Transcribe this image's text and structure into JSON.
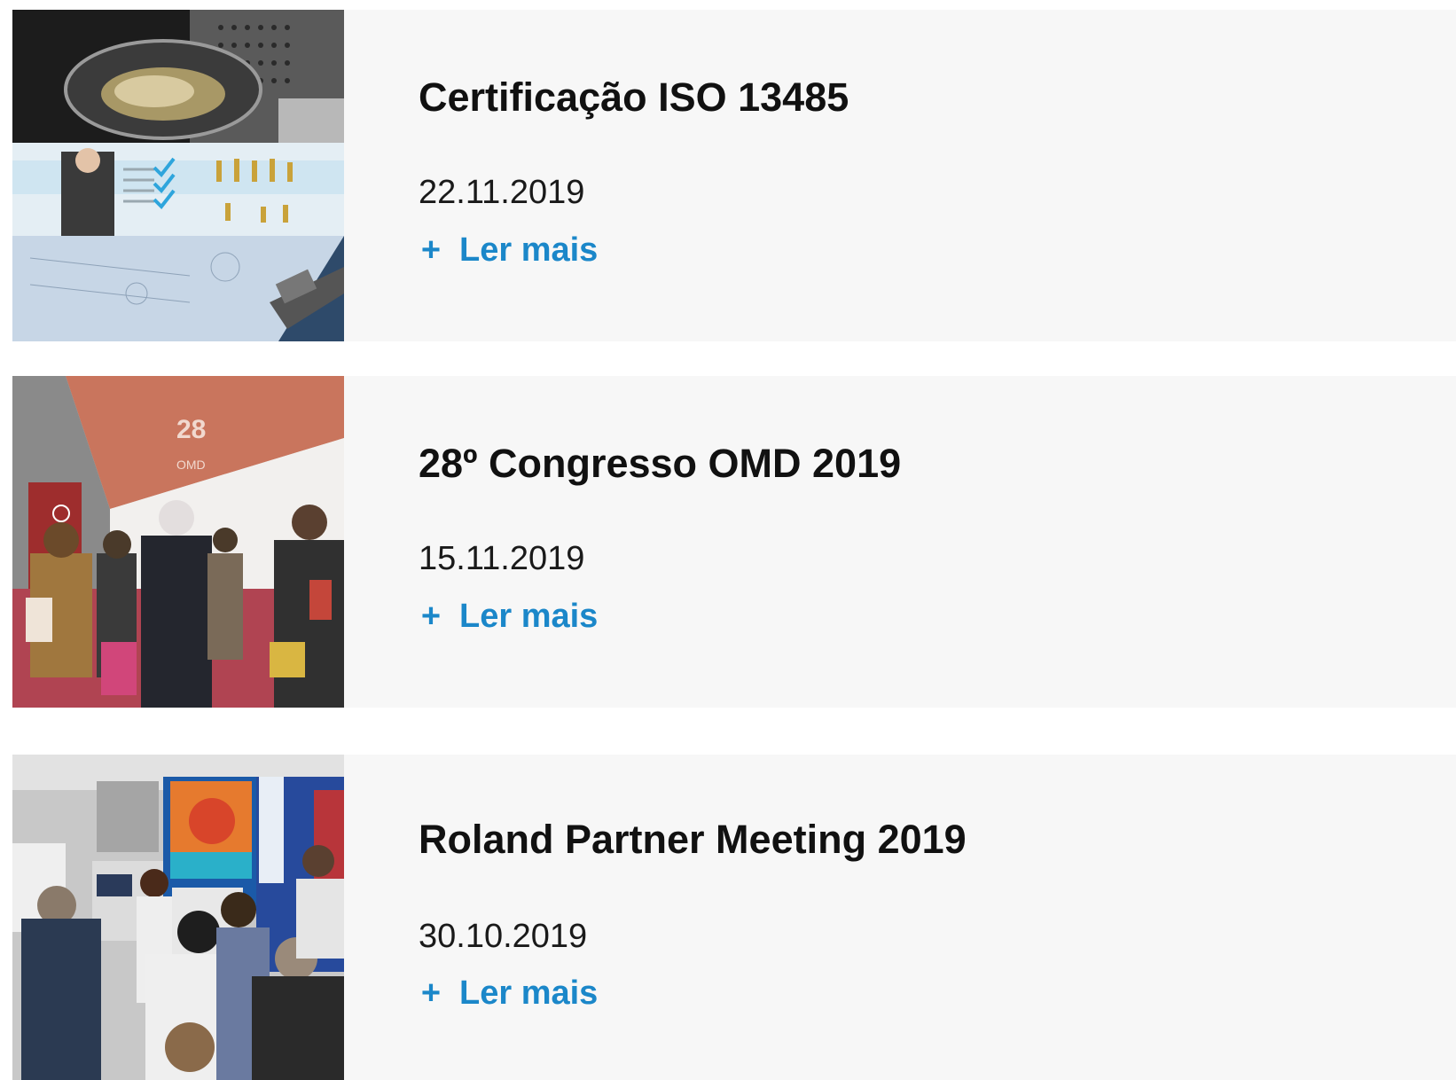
{
  "news": [
    {
      "title": "Certificação ISO 13485",
      "date": "22.11.2019",
      "read_more_icon": "+",
      "read_more_label": "Ler mais",
      "image_alt": "iso-certification-image"
    },
    {
      "title": "28º Congresso OMD 2019",
      "date": "15.11.2019",
      "read_more_icon": "+",
      "read_more_label": "Ler mais",
      "image_alt": "omd-congress-image"
    },
    {
      "title": "Roland Partner Meeting 2019",
      "date": "30.10.2019",
      "read_more_icon": "+",
      "read_more_label": "Ler mais",
      "image_alt": "roland-meeting-image"
    }
  ],
  "colors": {
    "card_background": "#f7f7f7",
    "link": "#1b87c9",
    "title": "#111111"
  }
}
